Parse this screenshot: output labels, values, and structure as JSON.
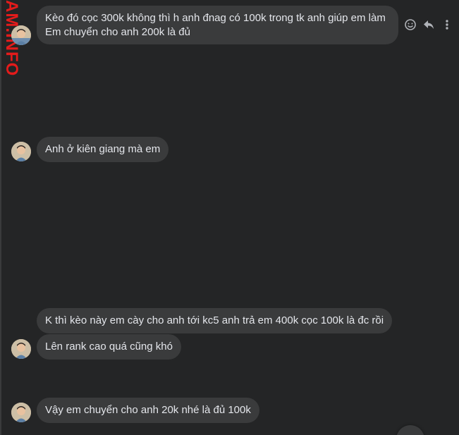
{
  "watermark": "AM.INFO",
  "messages": [
    {
      "lines": [
        "Kèo đó cọc 300k không thì h anh đnag có 100k trong tk anh giúp em làm",
        "Em chuyển cho anh 200k là đủ"
      ]
    },
    {
      "lines": [
        "Anh ở kiên giang mà em"
      ]
    },
    {
      "lines": [
        "K thì kèo này em cày cho anh tới kc5 anh trả em 400k cọc 100k là đc rồi"
      ]
    },
    {
      "lines": [
        "Lên rank cao quá cũng khó"
      ]
    },
    {
      "lines": [
        "Vậy em chuyển cho anh 20k nhé là đủ 100k"
      ]
    }
  ],
  "actions": {
    "react_icon": "smiley-icon",
    "reply_icon": "reply-icon",
    "more_icon": "more-vertical-icon"
  },
  "colors": {
    "background": "#242526",
    "bubble": "#3a3b3c",
    "text": "#e4e6eb",
    "watermark": "#e41b1b",
    "icon": "#b0b3b8"
  }
}
